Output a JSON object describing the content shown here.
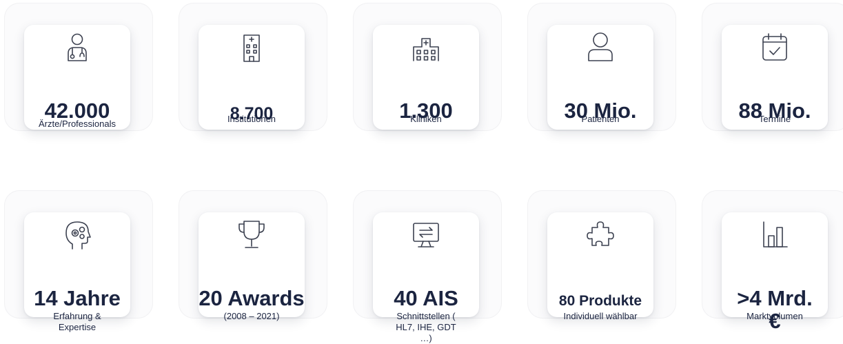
{
  "stats": [
    {
      "value": "42.000",
      "label": "Ärzte/Professionals",
      "icon": "doctor-icon"
    },
    {
      "value": "8.700",
      "label": "Institutionen",
      "icon": "building-icon"
    },
    {
      "value": "1.300",
      "label": "Kliniken",
      "icon": "hospital-icon"
    },
    {
      "value": "30 Mio.",
      "label": "Patienten",
      "icon": "person-icon"
    },
    {
      "value": "88 Mio.",
      "label": "Termine",
      "icon": "calendar-check-icon"
    },
    {
      "value": "14 Jahre",
      "label": "Erfahrung & Expertise",
      "icon": "head-gears-icon"
    },
    {
      "value": "20 Awards",
      "label": "(2008 – 2021)",
      "icon": "trophy-icon"
    },
    {
      "value": "40 AIS",
      "label": "Schnittstellen ( HL7, IHE, GDT …)",
      "icon": "monitor-exchange-icon"
    },
    {
      "value": "80 Produkte",
      "label": "Individuell wählbar",
      "icon": "puzzle-icon"
    },
    {
      "value": ">4 Mrd. €",
      "label": "Marktvolumen",
      "icon": "bar-chart-icon"
    }
  ],
  "colors": {
    "text": "#1b2440",
    "icon": "#3c4150",
    "tile": "#fbfbfc",
    "card": "#ffffff"
  }
}
